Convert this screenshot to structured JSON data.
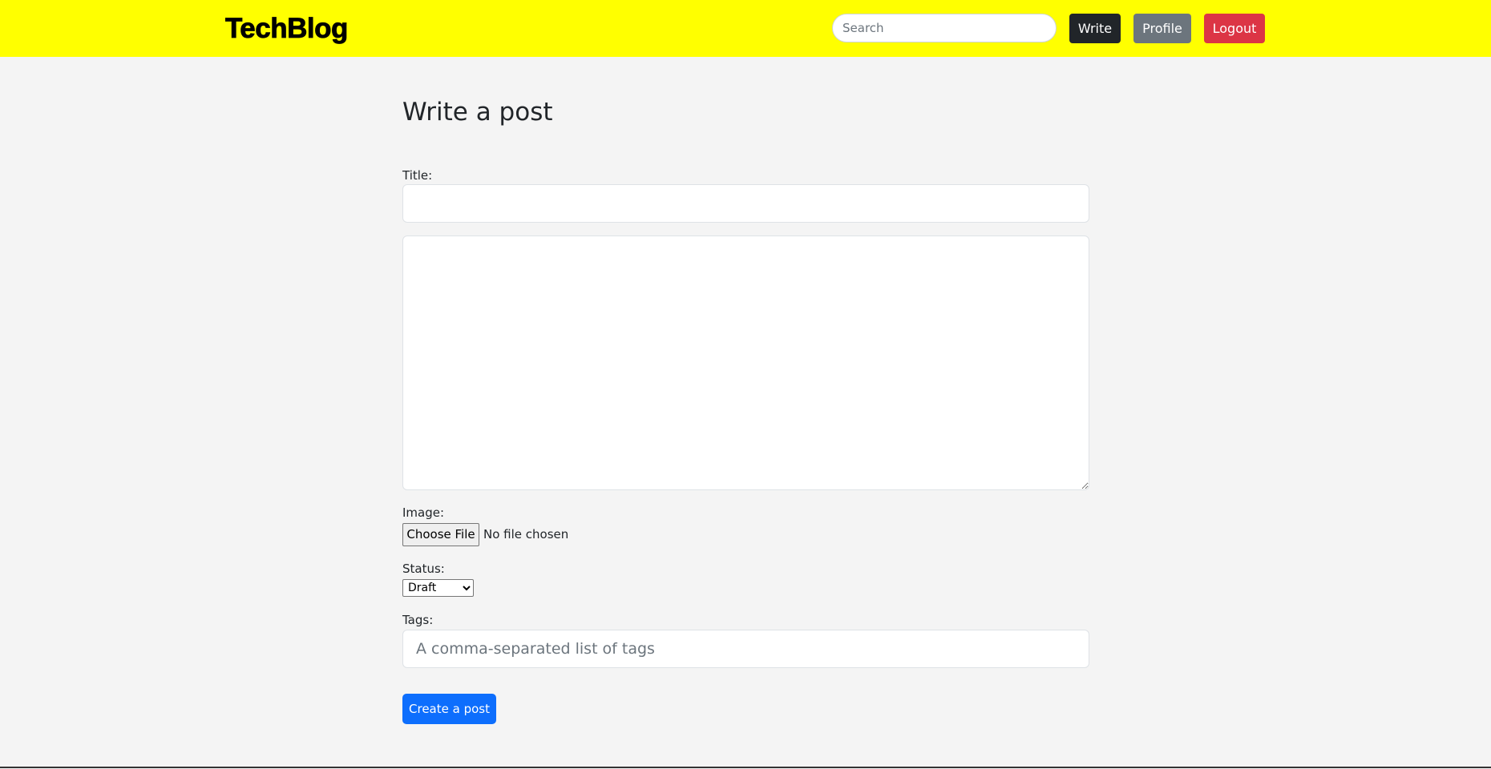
{
  "header": {
    "brand": "TechBlog",
    "search_placeholder": "Search",
    "search_value": "",
    "write_label": "Write",
    "profile_label": "Profile",
    "logout_label": "Logout"
  },
  "form": {
    "page_title": "Write a post",
    "title_label": "Title:",
    "title_value": "",
    "body_value": "",
    "image_label": "Image:",
    "file_button_label": "Choose File",
    "file_status": "No file chosen",
    "status_label": "Status:",
    "status_selected": "Draft",
    "tags_label": "Tags:",
    "tags_placeholder": "A comma-separated list of tags",
    "tags_value": "",
    "submit_label": "Create a post"
  },
  "colors": {
    "topbar": "#ffff00",
    "write_button": "#212529",
    "profile_button": "#6c757d",
    "logout_button": "#dc3545",
    "submit_button": "#0d6efd",
    "page_background": "#f4f4f4"
  }
}
